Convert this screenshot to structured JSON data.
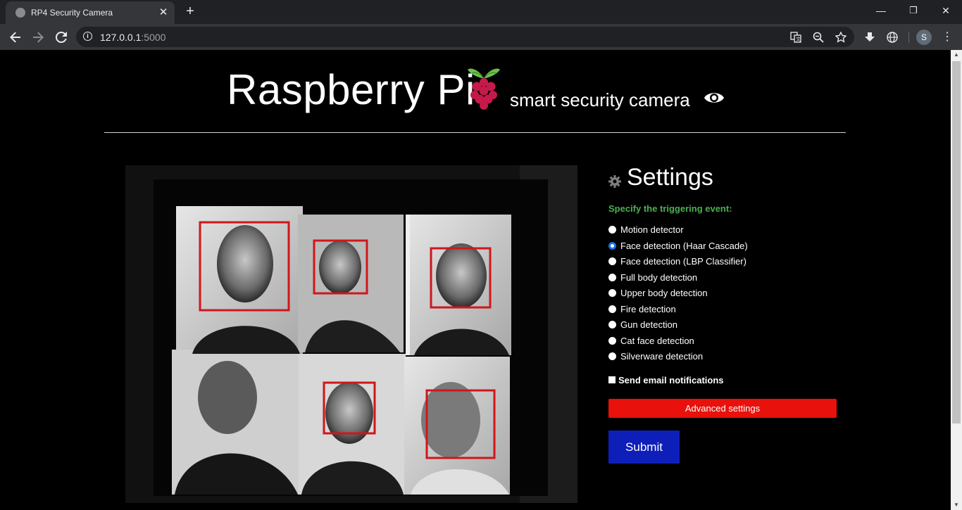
{
  "browser": {
    "tab_title": "RP4 Security Camera",
    "close_glyph": "✕",
    "new_tab_glyph": "+",
    "url_host": "127.0.0.1",
    "url_port": ":5000",
    "profile_initial": "S",
    "window_controls": {
      "minimize": "—",
      "restore": "❐",
      "close": "✕"
    }
  },
  "header": {
    "title": "Raspberry Pi",
    "subtitle": "smart security camera"
  },
  "settings": {
    "title": "Settings",
    "trigger_label": "Specify the triggering event:",
    "options": [
      {
        "label": "Motion detector",
        "checked": false
      },
      {
        "label": "Face detection (Haar Cascade)",
        "checked": true
      },
      {
        "label": "Face detection (LBP Classifier)",
        "checked": false
      },
      {
        "label": "Full body detection",
        "checked": false
      },
      {
        "label": "Upper body detection",
        "checked": false
      },
      {
        "label": "Fire detection",
        "checked": false
      },
      {
        "label": "Gun detection",
        "checked": false
      },
      {
        "label": "Cat face detection",
        "checked": false
      },
      {
        "label": "Silverware detection",
        "checked": false
      }
    ],
    "email_label": "Send email notifications",
    "email_checked": false,
    "advanced_label": "Advanced settings",
    "submit_label": "Submit"
  },
  "colors": {
    "accent_green": "#4caf50",
    "advanced_red": "#e8110c",
    "submit_blue": "#0d1fb8",
    "detection_box": "#d0161b"
  },
  "icons": [
    "globe-icon",
    "back-arrow-icon",
    "forward-arrow-icon",
    "reload-icon",
    "info-icon",
    "translate-icon",
    "zoom-icon",
    "star-icon",
    "download-icon",
    "extension-globe-icon",
    "raspberry-logo-icon",
    "eye-icon",
    "gear-icon"
  ]
}
